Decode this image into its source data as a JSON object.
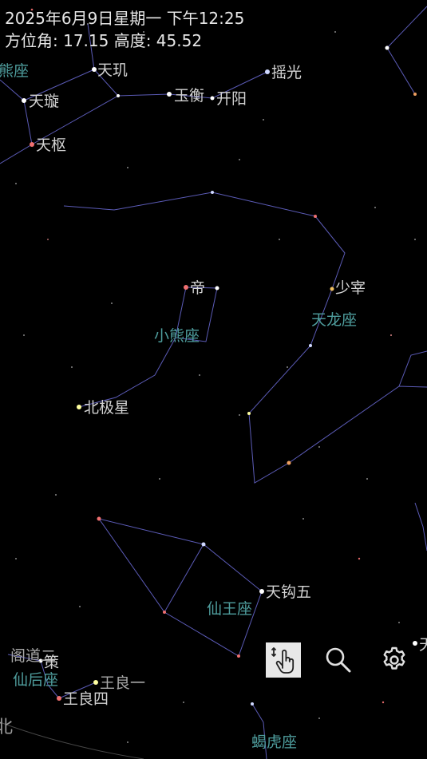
{
  "hud": {
    "datetime": "2025年6月9日星期一 下午12:25",
    "position": "方位角: 17.15 高度: 45.52"
  },
  "constellations": {
    "ursa_major": "熊座",
    "ursa_minor": "小熊座",
    "draco": "天龙座",
    "cepheus": "仙王座",
    "cassiopeia": "仙后座",
    "lacerta": "蝎虎座"
  },
  "stars": {
    "tianji": "天玑",
    "tianxuan": "天璇",
    "tianshu": "天枢",
    "yuheng": "玉衡",
    "kaiyang": "开阳",
    "yaoguang": "摇光",
    "di": "帝",
    "shaozai": "少宰",
    "polaris": "北极星",
    "tiangouwu": "天钩五",
    "gedaoer": "阁道二",
    "ce": "策",
    "wangliangyi": "王良一",
    "wangliangsi": "王良四",
    "edge_tian": "天",
    "edge_bei": "北"
  },
  "controls": {
    "gesture_icon": "hand-pointer-icon",
    "search_icon": "search-icon",
    "settings_icon": "gear-icon"
  },
  "colors": {
    "background": "#000000",
    "constellation_line": "#6b6bd6",
    "constellation_label": "#4f9e9e",
    "star_label": "#d2d2d2"
  }
}
